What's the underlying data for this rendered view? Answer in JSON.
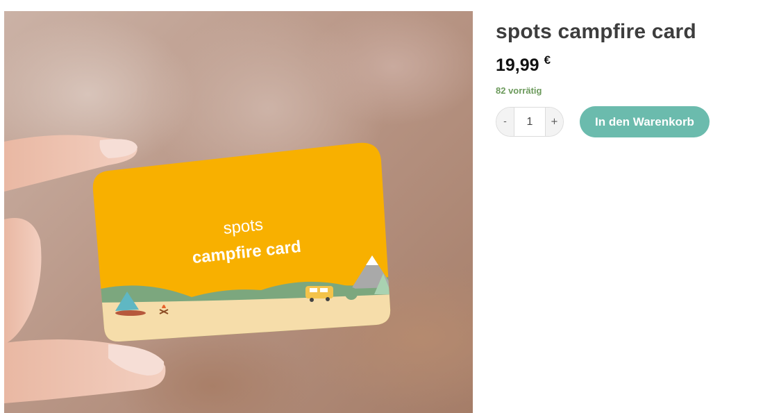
{
  "product": {
    "title": "spots campfire card",
    "price_amount": "19,99",
    "price_currency": "€",
    "stock": "82 vorrätig"
  },
  "card": {
    "line1": "spots",
    "line2": "campfire card"
  },
  "cart": {
    "qty_minus": "-",
    "qty_plus": "+",
    "qty_value": "1",
    "add_label": "In den Warenkorb"
  },
  "colors": {
    "accent": "#6bbbad",
    "stock": "#6c9a5c",
    "card_yellow": "#f8b000"
  }
}
